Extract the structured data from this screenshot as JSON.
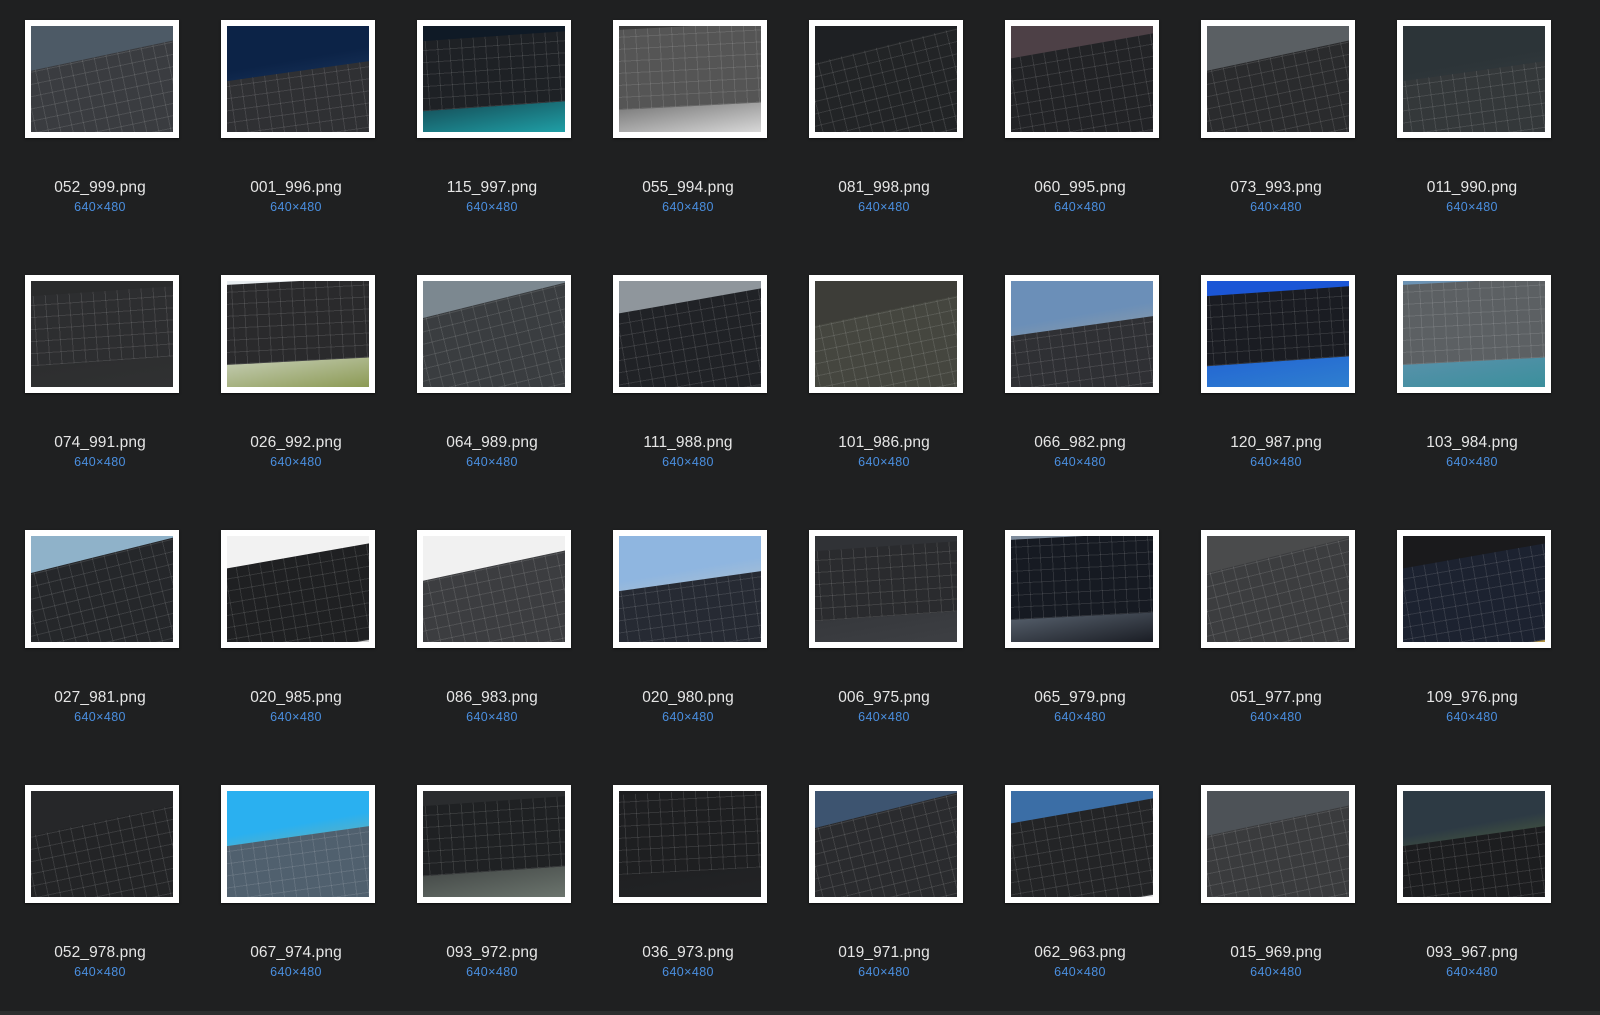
{
  "colors": {
    "background": "#1f2021",
    "filename_text": "#e6e6e6",
    "dimension_text": "#4a8fe0",
    "thumbnail_border": "#ffffff"
  },
  "icon": "image-thumbnail",
  "files": [
    {
      "name": "052_999.png",
      "dims": "640×480",
      "tone": [
        "#4d5a66",
        "#aab4bd"
      ],
      "board": "#3a3c40"
    },
    {
      "name": "001_996.png",
      "dims": "640×480",
      "tone": [
        "#0c2347",
        "#2d4f7a"
      ],
      "board": "#2f3033"
    },
    {
      "name": "115_997.png",
      "dims": "640×480",
      "tone": [
        "#0f1a26",
        "#1f9fa6"
      ],
      "board": "#1e2125"
    },
    {
      "name": "055_994.png",
      "dims": "640×480",
      "tone": [
        "#3a3a3a",
        "#d8d8d8"
      ],
      "board": "#555"
    },
    {
      "name": "081_998.png",
      "dims": "640×480",
      "tone": [
        "#1e2023",
        "#2a2c2f"
      ],
      "board": "#222426"
    },
    {
      "name": "060_995.png",
      "dims": "640×480",
      "tone": [
        "#4d4046",
        "#2c2d30"
      ],
      "board": "#222326"
    },
    {
      "name": "073_993.png",
      "dims": "640×480",
      "tone": [
        "#5a5f63",
        "#3b2a20"
      ],
      "board": "#2a2b2d"
    },
    {
      "name": "011_990.png",
      "dims": "640×480",
      "tone": [
        "#2c3438",
        "#3a4144"
      ],
      "board": "#34383a"
    },
    {
      "name": "074_991.png",
      "dims": "640×480",
      "tone": [
        "#2a2b2c",
        "#303132"
      ],
      "board": "#2d2e30"
    },
    {
      "name": "026_992.png",
      "dims": "640×480",
      "tone": [
        "#e8edf0",
        "#8c9a54"
      ],
      "board": "#2a2a2c"
    },
    {
      "name": "064_989.png",
      "dims": "640×480",
      "tone": [
        "#7c8890",
        "#3b4043"
      ],
      "board": "#3a3d40"
    },
    {
      "name": "111_988.png",
      "dims": "640×480",
      "tone": [
        "#8f969c",
        "#2e3134"
      ],
      "board": "#202226"
    },
    {
      "name": "101_986.png",
      "dims": "640×480",
      "tone": [
        "#3d3d38",
        "#5a5636"
      ],
      "board": "#45463f"
    },
    {
      "name": "066_982.png",
      "dims": "640×480",
      "tone": [
        "#6b8fb8",
        "#c4b08c"
      ],
      "board": "#2f3034"
    },
    {
      "name": "120_987.png",
      "dims": "640×480",
      "tone": [
        "#1b56d6",
        "#2f7fcf"
      ],
      "board": "#1a1c22"
    },
    {
      "name": "103_984.png",
      "dims": "640×480",
      "tone": [
        "#6c93b4",
        "#3b8f9c"
      ],
      "board": "#5c6063"
    },
    {
      "name": "027_981.png",
      "dims": "640×480",
      "tone": [
        "#8fb2c9",
        "#2c2e31"
      ],
      "board": "#25272a"
    },
    {
      "name": "020_985.png",
      "dims": "640×480",
      "tone": [
        "#f2f2f2",
        "#cfcfcf"
      ],
      "board": "#1f2022"
    },
    {
      "name": "086_983.png",
      "dims": "640×480",
      "tone": [
        "#f1f1f1",
        "#c9a36f"
      ],
      "board": "#3c3d40"
    },
    {
      "name": "020_980.png",
      "dims": "640×480",
      "tone": [
        "#8fb6e0",
        "#e0d2b8"
      ],
      "board": "#262a33"
    },
    {
      "name": "006_975.png",
      "dims": "640×480",
      "tone": [
        "#303236",
        "#3d3f43"
      ],
      "board": "#2a2b2e"
    },
    {
      "name": "065_979.png",
      "dims": "640×480",
      "tone": [
        "#7e8c9c",
        "#1a1d24"
      ],
      "board": "#161a22"
    },
    {
      "name": "051_977.png",
      "dims": "640×480",
      "tone": [
        "#4a4b4c",
        "#5a5b5c"
      ],
      "board": "#3c3d3f"
    },
    {
      "name": "109_976.png",
      "dims": "640×480",
      "tone": [
        "#1a1a1c",
        "#b29444"
      ],
      "board": "#1c2230"
    },
    {
      "name": "052_978.png",
      "dims": "640×480",
      "tone": [
        "#262729",
        "#2d2e30"
      ],
      "board": "#232426"
    },
    {
      "name": "067_974.png",
      "dims": "640×480",
      "tone": [
        "#2ab0f0",
        "#d9b24a"
      ],
      "board": "#50606e"
    },
    {
      "name": "093_972.png",
      "dims": "640×480",
      "tone": [
        "#2a2c2e",
        "#6b746d"
      ],
      "board": "#1f2123"
    },
    {
      "name": "036_973.png",
      "dims": "640×480",
      "tone": [
        "#1c1d1f",
        "#232426"
      ],
      "board": "#1e1f21"
    },
    {
      "name": "019_971.png",
      "dims": "640×480",
      "tone": [
        "#3d5470",
        "#a2704a"
      ],
      "board": "#2a2b2e"
    },
    {
      "name": "062_963.png",
      "dims": "640×480",
      "tone": [
        "#3b6ea6",
        "#e8e8e8"
      ],
      "board": "#232426"
    },
    {
      "name": "015_969.png",
      "dims": "640×480",
      "tone": [
        "#4d5257",
        "#4d7fb6"
      ],
      "board": "#3a3b3d"
    },
    {
      "name": "093_967.png",
      "dims": "640×480",
      "tone": [
        "#2d3a44",
        "#7e9a32"
      ],
      "board": "#1c1d1f"
    }
  ]
}
